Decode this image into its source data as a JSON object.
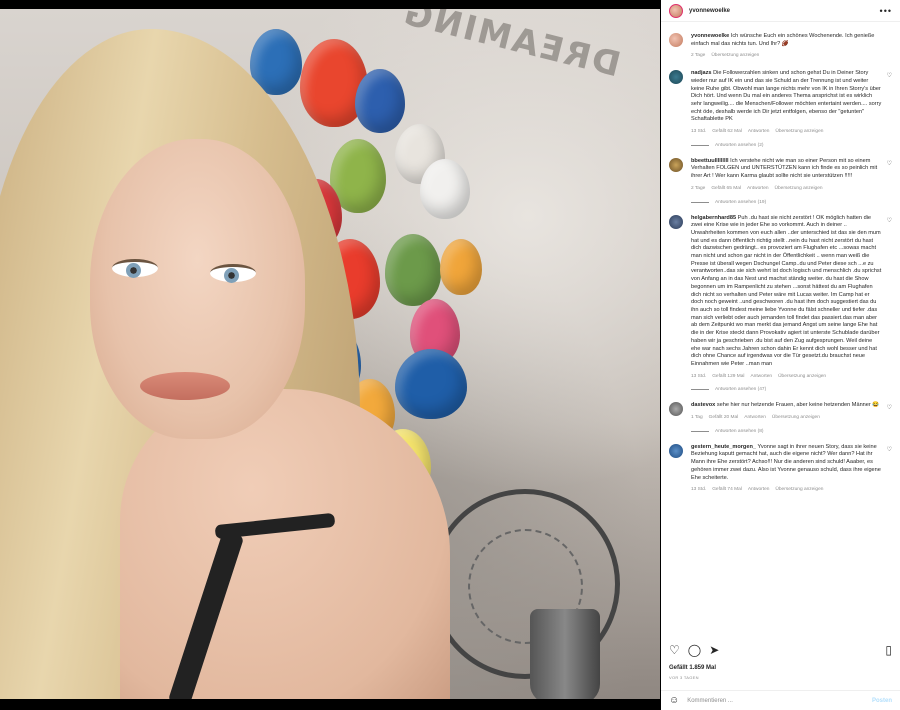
{
  "post": {
    "username": "yvonnewoelke",
    "more_icon": "more-horizontal-icon",
    "caption": {
      "user": "yvonnewoelke",
      "text": "Ich wünsche Euch ein schönes Wochenende. Ich genieße einfach mal das nichts tun. Und Ihr? 🏈",
      "time": "2 Tage",
      "translate": "Übersetzung anzeigen"
    },
    "comments": [
      {
        "user": "nadjazs",
        "text": "Die Followerzahlen sinken und schon gehst Du in Deiner Story wieder nur auf IK ein und das sie Schuld an der Trennung ist und weiter keine Ruhe gibt. Obwohl man lange nichts mehr von IK in Ihren Storry's über Dich hört. Und wenn Du mal ein anderes Thema ansprichst ist es wirklich sehr langweilig.... die Menschen/Follower möchten entertaint werden.... sorry echt öde, deshalb werde ich Dir jetzt entfolgen, ebenso der \"getunten\" Schaftablette PK",
        "time": "13 Std.",
        "likes": "Gefällt 62 Mal",
        "reply": "Antworten",
        "translate": "Übersetzung anzeigen",
        "replies": "Antworten ansehen (2)"
      },
      {
        "user": "bbeettuulllllllll",
        "text": "Ich verstehe nicht wie man so einer Person mit so einem Verhalten FOLGEN und UNTERSTÜTZEN kann ich finde es so peinlich mit ihrer Art ! Wer kann Karma glaubt sollte nicht sie unterstützen !!!!!",
        "time": "2 Tage",
        "likes": "Gefällt 65 Mal",
        "reply": "Antworten",
        "translate": "Übersetzung anzeigen",
        "replies": "Antworten ansehen (19)"
      },
      {
        "user": "helgabernhard85",
        "text": "Puh .du hast sie nicht zerstört ! OK möglich hatten die zwei eine Krise wie in jeder Ehe so vorkommt. Auch in deiner .. Unwahrheiten kommen von euch allen ..der unterschied ist das sie den mum hat und es dann öffentlich richtig stellt ..nein du hast nicht zerstört du hast dich dazwischen gedrängt.. es provoziert am Flughafen etc ...sowas macht man nicht und schon gar nicht in der Öffentlichkeit .. wenn man weiß die Presse ist überall wegen Dschungel Camp..du und Peter diese sch ...e zu verantworten..das sie sich wehrt ist doch logisch und menschlich .du sprichst von Anfang an in das Nest und machst ständig weiter. du hast die Show begonnen um im Rampenlicht zu stehen ...sonst hättest du am Flughafen dich nicht so verhalten und Peter wäre mit Lucas weiter. Im Camp hat er doch noch geweint ..und geschworen .du hast ihm doch suggestiert das du ihn auch so toll findest meine liebe Yvonne du fälst schneller und tiefer .das man sich verliebt oder auch jemanden toll findet das passiert.das man aber ab dem Zeitpunkt wo man merkt das jemand Angst um seine lange Ehe hat die in der Krise steckt dann Provokativ agiert ist unterste Schublade darüber haben wir ja geschrieben .du bist auf den Zug aufgesprungen. Weil deine ehe war nach sechs Jahren schon dahin Er kennt dich wohl besser und hat dich ohne Chance auf irgendwas vor die Tür gesetzt.du brauchst neue Einnahmen wie Peter ..man man",
        "time": "13 Std.",
        "likes": "Gefällt 129 Mal",
        "reply": "Antworten",
        "translate": "Übersetzung anzeigen",
        "replies": "Antworten ansehen (47)"
      },
      {
        "user": "dastevox",
        "text": "sehe hier nur hetzende Frauen, aber keine hetzenden Männer 😂",
        "time": "1 Tag",
        "likes": "Gefällt 20 Mal",
        "reply": "Antworten",
        "translate": "Übersetzung anzeigen",
        "replies": "Antworten ansehen (8)"
      },
      {
        "user": "gestern_heute_morgen_",
        "text": "Yvonne sagt in ihrer neuen Story, dass sie keine Beziehung kaputt gemacht hat, auch die eigene nicht? Wer dann? Hat ihr Mann ihre Ehe zerstört? Achso!!! Nur die anderen sind schuld! Aaaber, es gehören immer zwei dazu. Also ist Yvonne genauso schuld, dass ihre eigene Ehe scheiterte.",
        "time": "13 Std.",
        "likes": "Gefällt 74 Mal",
        "reply": "Antworten",
        "translate": "Übersetzung anzeigen",
        "replies": ""
      }
    ],
    "likes_total": "Gefällt 1.859 Mal",
    "ago": "VOR 3 TAGEN",
    "add_comment_placeholder": "Kommentieren ...",
    "post_button": "Posten",
    "photo_wall_text": "DREAMING",
    "icons": {
      "like": "heart-icon",
      "comment": "comment-icon",
      "share": "share-icon",
      "save": "bookmark-icon",
      "emoji": "emoji-icon"
    }
  }
}
